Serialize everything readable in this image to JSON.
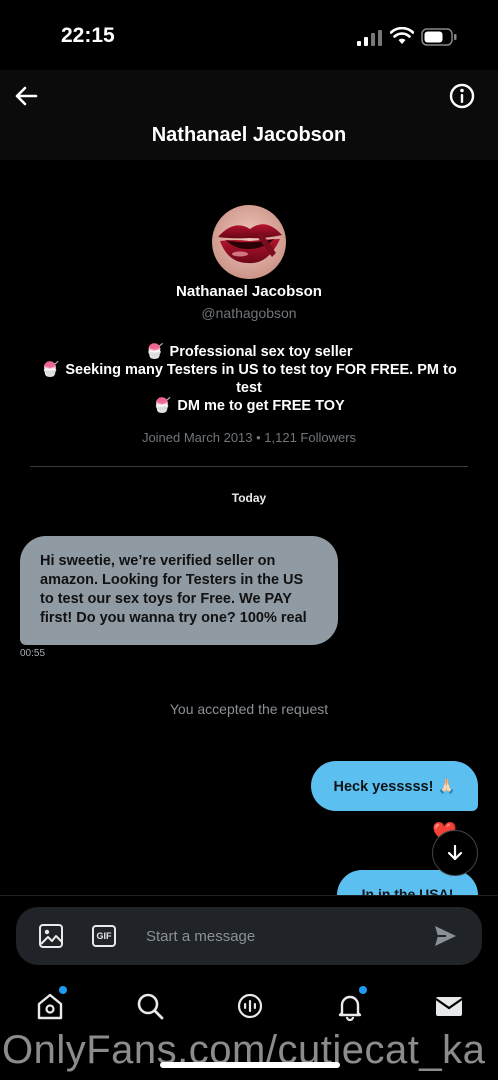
{
  "status_bar": {
    "time": "22:15"
  },
  "header": {
    "title": "Nathanael Jacobson"
  },
  "profile": {
    "name": "Nathanael Jacobson",
    "handle": "@nathagobson",
    "bio": [
      {
        "emoji": "🍧",
        "text": "Professional sex toy seller"
      },
      {
        "emoji": "🍧",
        "text": "Seeking many Testers in US to test toy FOR FREE. PM to test"
      },
      {
        "emoji": "🍧",
        "text": "DM me to get FREE TOY"
      }
    ],
    "joined": "Joined March 2013 • 1,121 Followers"
  },
  "conversation": {
    "day_label": "Today",
    "incoming": {
      "text": "Hi sweetie, we’re verified seller on amazon. Looking for Testers in the US to test our sex toys for Free. We PAY first! Do you wanna try one? 100% real",
      "time": "00:55"
    },
    "system_message": "You accepted the request",
    "outgoing": [
      {
        "text": "Heck yesssss! 🙏🏻"
      },
      {
        "text": "In in the USA!"
      }
    ],
    "reaction": "❤️"
  },
  "composer": {
    "placeholder": "Start a message",
    "gif_label": "GIF"
  },
  "watermark": "OnlyFans.com/cutiecat_ka",
  "colors": {
    "accent": "#1d9bf0",
    "outgoing_bubble": "#5bc0f0",
    "incoming_bubble": "#8f9aa3"
  }
}
